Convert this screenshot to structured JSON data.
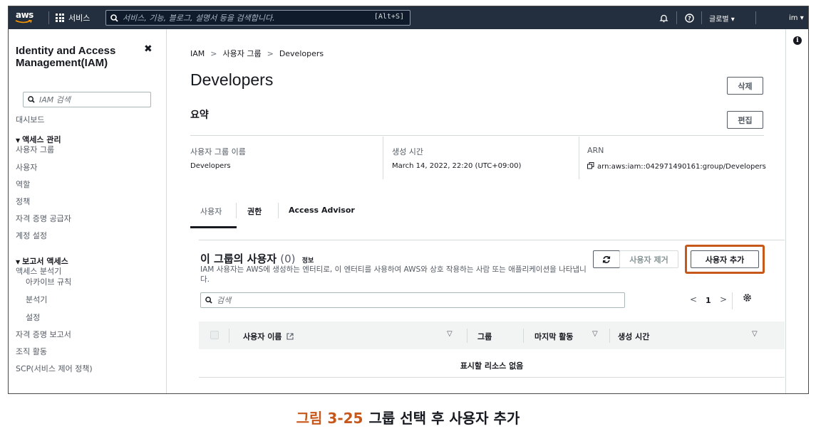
{
  "topnav": {
    "logo": "aws",
    "services_label": "서비스",
    "search_placeholder": "서비스, 기능, 블로그, 설명서 등을 검색합니다.",
    "search_shortcut": "[Alt+S]",
    "region_label": "글로벌 ▾",
    "user_label": "im ▾",
    "colors": {
      "bg": "#232f3e",
      "accent": "#ff9900"
    }
  },
  "sidebar": {
    "title": "Identity and Access Management(IAM)",
    "search_placeholder": "IAM 검색",
    "dashboard": "대시보드",
    "access_mgmt_heading": "액세스 관리",
    "access_items": [
      "사용자 그룹",
      "사용자",
      "역할",
      "정책",
      "자격 증명 공급자",
      "계정 설정"
    ],
    "reports_heading": "보고서 액세스",
    "report_items": [
      "액세스 분석기",
      "아카이브 규칙",
      "분석기",
      "설정",
      "자격 증명 보고서",
      "조직 활동",
      "SCP(서비스 제어 정책)"
    ]
  },
  "main": {
    "breadcrumb": [
      "IAM",
      "사용자 그룹",
      "Developers"
    ],
    "title": "Developers",
    "delete_button": "삭제",
    "summary_title": "요약",
    "edit_button": "편집",
    "summary": {
      "group_name_label": "사용자 그룹 이름",
      "group_name_value": "Developers",
      "created_label": "생성 시간",
      "created_value": "March 14, 2022, 22:20 (UTC+09:00)",
      "arn_label": "ARN",
      "arn_value": "arn:aws:iam::042971490161:group/Developers"
    },
    "tabs": [
      "사용자",
      "권한",
      "Access Advisor"
    ],
    "users_panel": {
      "title": "이 그룹의 사용자",
      "count": "(0)",
      "info": "정보",
      "description": "IAM 사용자는 AWS에 생성하는 엔터티로, 이 엔터티를 사용하여 AWS와 상호 작용하는 사람 또는 애플리케이션을 나타냅니다.",
      "remove_button": "사용자 제거",
      "add_button": "사용자 추가",
      "search_placeholder": "검색",
      "page": "1",
      "columns": [
        "사용자 이름",
        "그룹",
        "마지막 활동",
        "생성 시간"
      ],
      "empty_text": "표시할 리소스 없음"
    }
  },
  "caption": {
    "number": "그림 3-25",
    "text": "그룹 선택 후 사용자 추가",
    "color": "#c7581c"
  }
}
